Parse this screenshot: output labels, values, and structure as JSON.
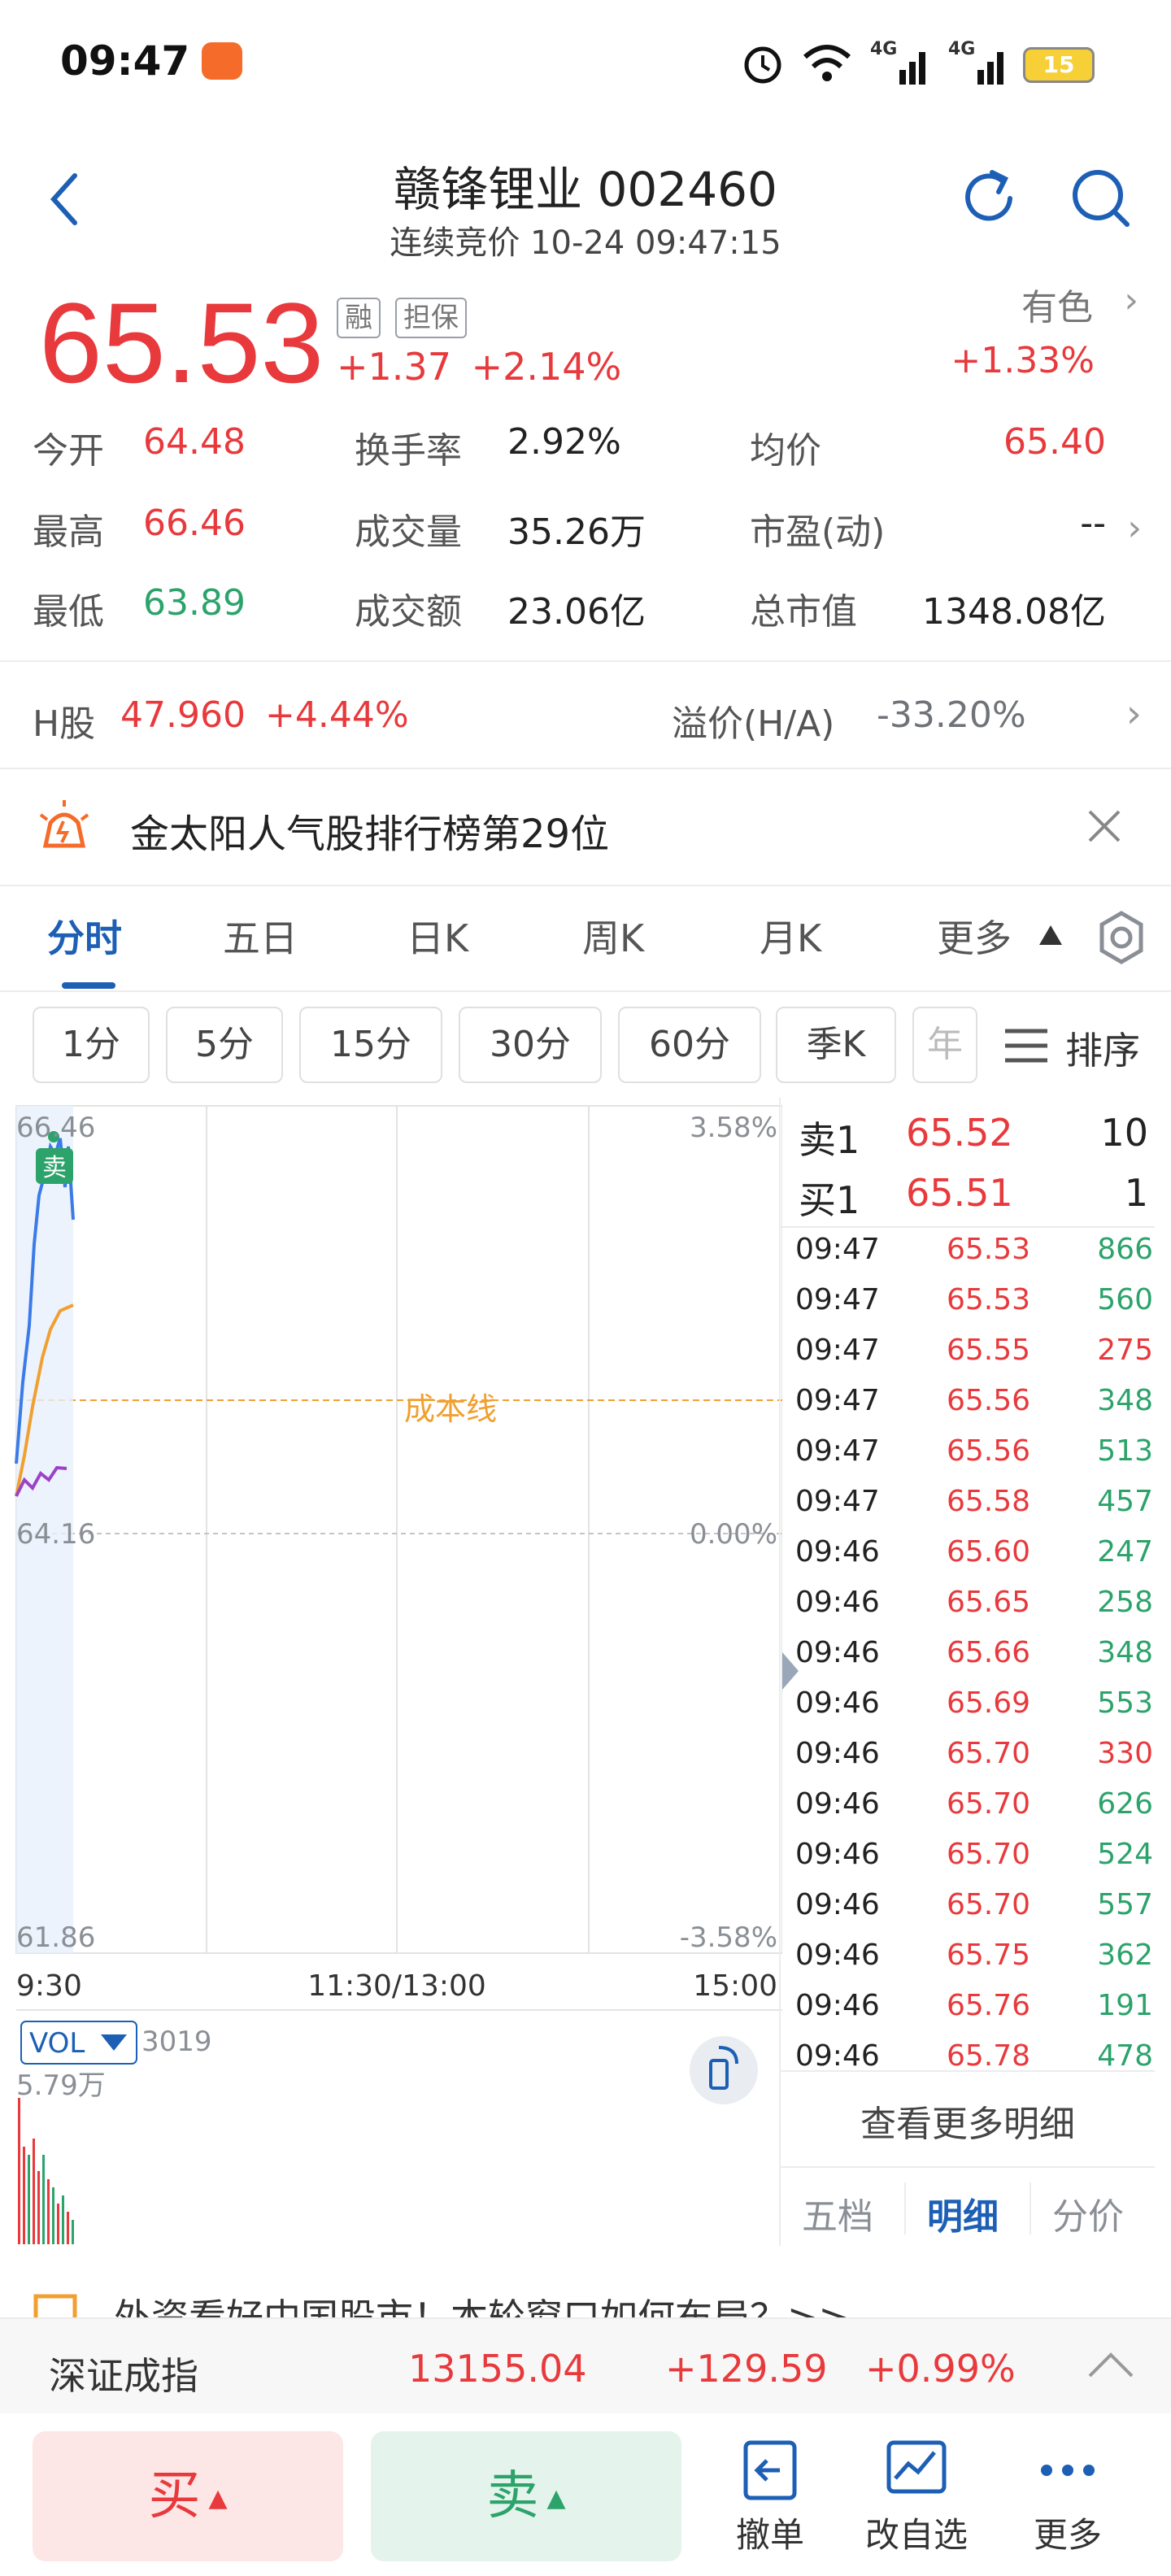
{
  "status_bar": {
    "time": "09:47",
    "battery": "15",
    "network_1": "4G",
    "network_2": "4G"
  },
  "header": {
    "title": "赣锋锂业 002460",
    "subtitle": "连续竞价 10-24 09:47:15"
  },
  "quote": {
    "price": "65.53",
    "tag_margin": "融",
    "tag_collateral": "担保",
    "change": "+1.37",
    "change_pct": "+2.14%",
    "sector_name": "有色",
    "sector_change": "+1.33%"
  },
  "stats": {
    "open_label": "今开",
    "open_val": "64.48",
    "high_label": "最高",
    "high_val": "66.46",
    "low_label": "最低",
    "low_val": "63.89",
    "turnover_label": "换手率",
    "turnover_val": "2.92%",
    "volume_label": "成交量",
    "volume_val": "35.26万",
    "amount_label": "成交额",
    "amount_val": "23.06亿",
    "avg_label": "均价",
    "avg_val": "65.40",
    "pe_label": "市盈(动)",
    "pe_val": "--",
    "mcap_label": "总市值",
    "mcap_val": "1348.08亿"
  },
  "h_share": {
    "label": "H股",
    "price": "47.960",
    "change_pct": "+4.44%",
    "premium_label": "溢价(H/A)",
    "premium_val": "-33.20%"
  },
  "banner": {
    "text": "金太阳人气股排行榜第29位"
  },
  "tabs": [
    "分时",
    "五日",
    "日K",
    "周K",
    "月K",
    "更多"
  ],
  "intervals": [
    "1分",
    "5分",
    "15分",
    "30分",
    "60分",
    "季K",
    "年"
  ],
  "sort_label": "排序",
  "chart": {
    "y_top": "66.46",
    "y_mid": "64.16",
    "y_bottom": "61.86",
    "pct_top": "3.58%",
    "pct_mid": "0.00%",
    "pct_bottom": "-3.58%",
    "x_start": "9:30",
    "x_mid": "11:30/13:00",
    "x_end": "15:00",
    "cost_line_label": "成本线",
    "sell_marker": "卖",
    "vol_label": "VOL",
    "vol_value": "3019",
    "vol_max": "5.79万"
  },
  "colors": {
    "up": "#e8393c",
    "down": "#2ca36b",
    "accent": "#1d5fb5",
    "price_line": "#3b7be8",
    "avg_line": "#f0a030"
  },
  "order_book": {
    "ask_label": "卖1",
    "ask_price": "65.52",
    "ask_vol": "10",
    "bid_label": "买1",
    "bid_price": "65.51",
    "bid_vol": "1",
    "ticks": [
      {
        "time": "09:47",
        "price": "65.53",
        "vol": "866",
        "dir": "up"
      },
      {
        "time": "09:47",
        "price": "65.53",
        "vol": "560",
        "dir": "up"
      },
      {
        "time": "09:47",
        "price": "65.55",
        "vol": "275",
        "dir": "down"
      },
      {
        "time": "09:47",
        "price": "65.56",
        "vol": "348",
        "dir": "up"
      },
      {
        "time": "09:47",
        "price": "65.56",
        "vol": "513",
        "dir": "up"
      },
      {
        "time": "09:47",
        "price": "65.58",
        "vol": "457",
        "dir": "up"
      },
      {
        "time": "09:46",
        "price": "65.60",
        "vol": "247",
        "dir": "up"
      },
      {
        "time": "09:46",
        "price": "65.65",
        "vol": "258",
        "dir": "up"
      },
      {
        "time": "09:46",
        "price": "65.66",
        "vol": "348",
        "dir": "up"
      },
      {
        "time": "09:46",
        "price": "65.69",
        "vol": "553",
        "dir": "up"
      },
      {
        "time": "09:46",
        "price": "65.70",
        "vol": "330",
        "dir": "down"
      },
      {
        "time": "09:46",
        "price": "65.70",
        "vol": "626",
        "dir": "up"
      },
      {
        "time": "09:46",
        "price": "65.70",
        "vol": "524",
        "dir": "up"
      },
      {
        "time": "09:46",
        "price": "65.70",
        "vol": "557",
        "dir": "up"
      },
      {
        "time": "09:46",
        "price": "65.75",
        "vol": "362",
        "dir": "up"
      },
      {
        "time": "09:46",
        "price": "65.76",
        "vol": "191",
        "dir": "up"
      },
      {
        "time": "09:46",
        "price": "65.78",
        "vol": "478",
        "dir": "up"
      }
    ],
    "more_label": "查看更多明细",
    "tabs": [
      "五档",
      "明细",
      "分价"
    ]
  },
  "news_ticker": "外资看好中国股市！本轮窗口如何布局？>>",
  "index_bar": {
    "name": "深证成指",
    "value": "13155.04",
    "change": "+129.59",
    "change_pct": "+0.99%"
  },
  "bottom": {
    "buy": "买",
    "sell": "卖",
    "cancel": "撤单",
    "edit_watch": "改自选",
    "more": "更多"
  }
}
